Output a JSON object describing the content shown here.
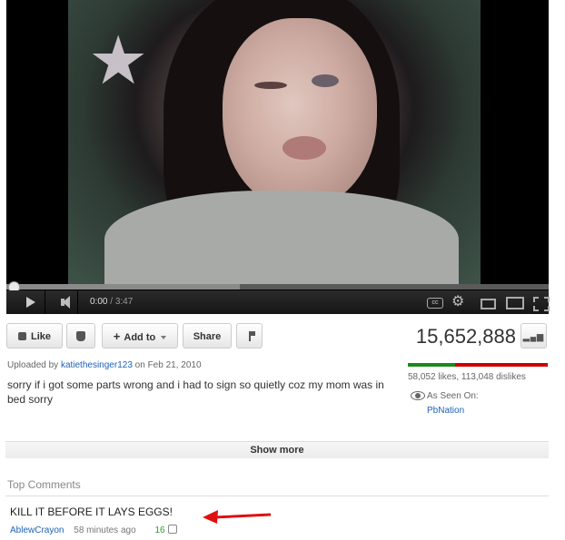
{
  "player": {
    "time_current": "0:00",
    "time_total": "3:47",
    "cc_label": "cc",
    "loaded_fraction": 0.43
  },
  "actions": {
    "like_label": "Like",
    "add_to_label": "Add to",
    "share_label": "Share"
  },
  "stats": {
    "view_count": "15,652,888",
    "likes_summary": "58,052 likes, 113,048 dislikes",
    "like_fraction": 0.34
  },
  "upload": {
    "prefix": "Uploaded by",
    "uploader": "katiethesinger123",
    "date_text": "on Feb 21, 2010",
    "description": "sorry if i got some parts wrong and i had to sign so quietly coz my mom was in bed sorry"
  },
  "seen_on": {
    "label": "As Seen On:",
    "link": "PbNation"
  },
  "show_more_label": "Show more",
  "comments": {
    "heading": "Top Comments",
    "items": [
      {
        "text": "KILL IT BEFORE IT LAYS EGGS!",
        "author": "AblewCrayon",
        "time": "58 minutes ago",
        "score": "16"
      }
    ]
  },
  "colors": {
    "link": "#1c62b9",
    "like_green": "#1b8a1b",
    "dislike_red": "#cc0000",
    "arrow_red": "#e01010"
  },
  "icons": [
    "play-icon",
    "volume-icon",
    "cc-icon",
    "gear-icon",
    "small-player-icon",
    "large-player-icon",
    "fullscreen-icon",
    "thumbs-up-icon",
    "thumbs-down-icon",
    "flag-icon",
    "stats-icon",
    "eye-icon",
    "red-arrow"
  ]
}
